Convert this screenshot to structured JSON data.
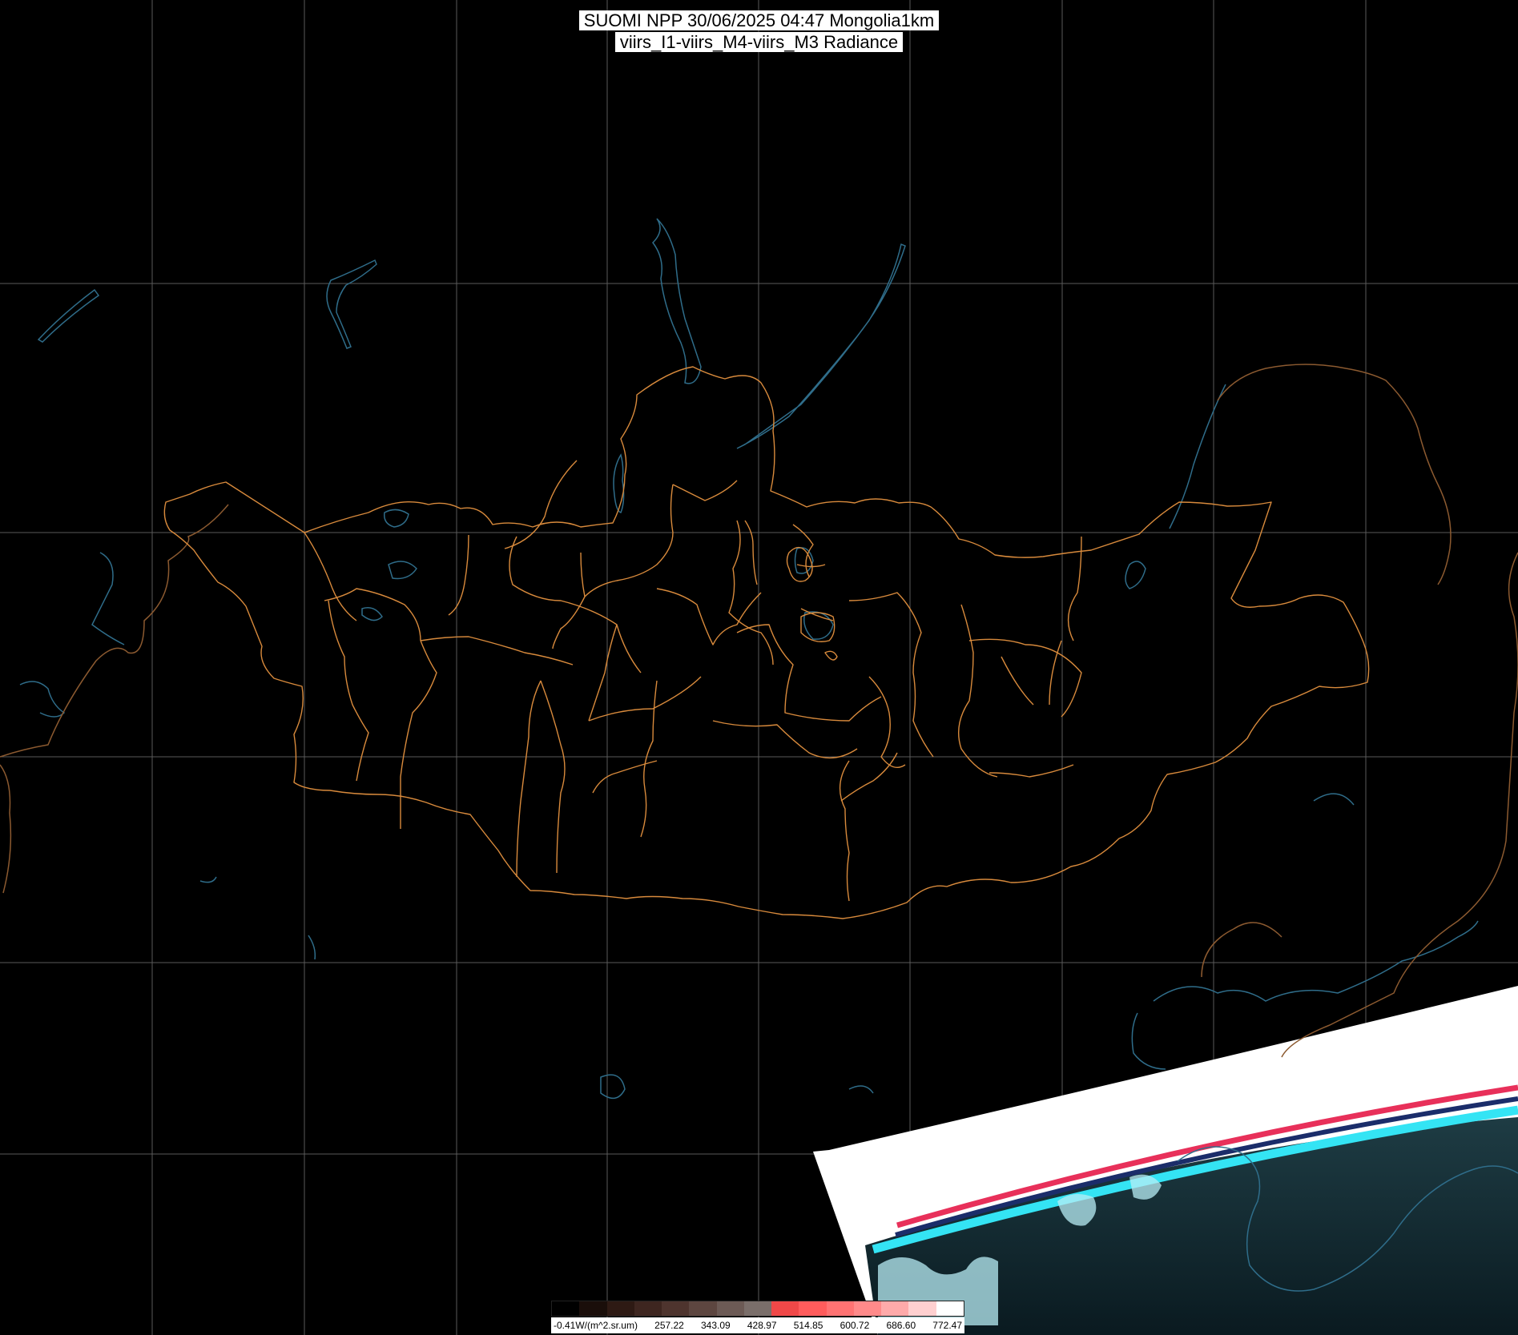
{
  "title": {
    "line1": "SUOMI NPP 30/06/2025 04:47 Mongolia1km",
    "line2": "viirs_I1-viirs_M4-viirs_M3 Radiance"
  },
  "legend": {
    "unit_label": "-0.41W/(m^2.sr.um)",
    "tick_values": [
      "257.22",
      "343.09",
      "428.97",
      "514.85",
      "600.72",
      "686.60",
      "772.47"
    ],
    "swatch_colors": [
      "#000000",
      "#1a0e0a",
      "#2e1a14",
      "#3e2620",
      "#4e342e",
      "#5d4640",
      "#6c5a55",
      "#7a6e6a",
      "#f04848",
      "#ff5c5c",
      "#ff7373",
      "#ff8a8a",
      "#ffaaaa",
      "#ffd0d0",
      "#ffffff"
    ]
  },
  "colors": {
    "background": "#000000",
    "graticule": "#5a5a5a",
    "country_border": "#8c5a30",
    "aimag_border": "#d88a3c",
    "coastline_water": "#2f6d8a",
    "swath_white": "#ffffff",
    "swath_cyan": "#34e4f4",
    "swath_red": "#e8305a"
  },
  "map": {
    "projection_grid": "graticule",
    "region": "Mongolia",
    "swath_visible": true
  }
}
